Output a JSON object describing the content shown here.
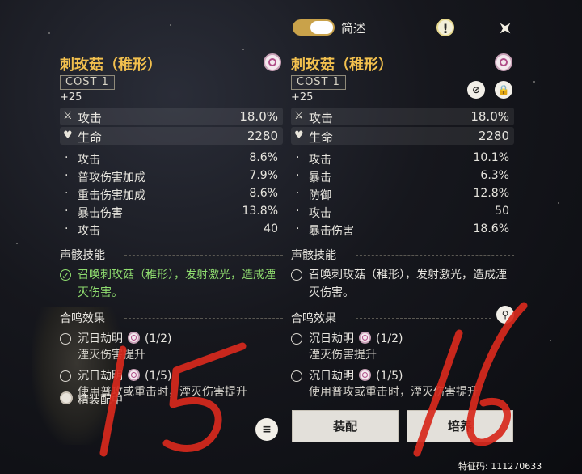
{
  "header": {
    "toggle_label": "简述",
    "info_icon_glyph": "!"
  },
  "left": {
    "name": "刺玫菇（稚形）",
    "cost": "COST 1",
    "level": "+25",
    "main_stats": [
      {
        "label": "攻击",
        "value": "18.0%",
        "icon": "swords-icon"
      },
      {
        "label": "生命",
        "value": "2280",
        "icon": "heart-icon"
      }
    ],
    "sub_stats": [
      {
        "label": "攻击",
        "value": "8.6%"
      },
      {
        "label": "普攻伤害加成",
        "value": "7.9%"
      },
      {
        "label": "重击伤害加成",
        "value": "8.6%"
      },
      {
        "label": "暴击伤害",
        "value": "13.8%"
      },
      {
        "label": "攻击",
        "value": "40"
      }
    ],
    "skill_title": "声骸技能",
    "skill_text": "召唤刺玫菇（稚形），发射激光，造成湮灭伤害。",
    "set_title": "合鸣效果",
    "sets": [
      {
        "name": "沉日劫明",
        "count": "(1/2)",
        "desc": "湮灭伤害提升"
      },
      {
        "name": "沉日劫明",
        "count": "(1/5)",
        "desc": "使用普攻或重击时，湮灭伤害提升"
      }
    ],
    "equipped_label": "精装配中"
  },
  "right": {
    "name": "刺玫菇（稚形）",
    "cost": "COST 1",
    "level": "+25",
    "main_stats": [
      {
        "label": "攻击",
        "value": "18.0%",
        "icon": "swords-icon"
      },
      {
        "label": "生命",
        "value": "2280",
        "icon": "heart-icon"
      }
    ],
    "sub_stats": [
      {
        "label": "攻击",
        "value": "10.1%"
      },
      {
        "label": "暴击",
        "value": "6.3%"
      },
      {
        "label": "防御",
        "value": "12.8%"
      },
      {
        "label": "攻击",
        "value": "50"
      },
      {
        "label": "暴击伤害",
        "value": "18.6%"
      }
    ],
    "skill_title": "声骸技能",
    "skill_text": "召唤刺玫菇（稚形），发射激光，造成湮灭伤害。",
    "set_title": "合鸣效果",
    "sets": [
      {
        "name": "沉日劫明",
        "count": "(1/2)",
        "desc": "湮灭伤害提升"
      },
      {
        "name": "沉日劫明",
        "count": "(1/5)",
        "desc": "使用普攻或重击时，湮灭伤害提升"
      }
    ]
  },
  "actions": {
    "equip_label": "装配",
    "upgrade_label": "培养"
  },
  "feature_code": "特征码: 111270633",
  "handwriting": "15   16",
  "colors": {
    "accent_gold": "#f2c04e",
    "skill_active": "#8fdc6f",
    "handwriting_red": "#d8291d"
  }
}
